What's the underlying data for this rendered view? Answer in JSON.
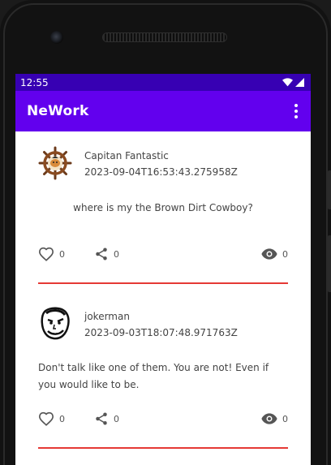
{
  "statusbar": {
    "time": "12:55"
  },
  "appbar": {
    "title": "NeWork"
  },
  "posts": [
    {
      "author": "Capitan Fantastic",
      "published": "2023-09-04T16:53:43.275958Z",
      "content": "where is my the Brown Dirt Cowboy?",
      "likes": "0",
      "shares": "0",
      "views": "0"
    },
    {
      "author": "jokerman",
      "published": "2023-09-03T18:07:48.971763Z",
      "content": "Don't talk like one of them. You are not! Even if you would like to be.",
      "likes": "0",
      "shares": "0",
      "views": "0"
    }
  ],
  "colors": {
    "statusbar": "#3700B3",
    "appbar": "#6200EE",
    "divider": "#E53935"
  }
}
